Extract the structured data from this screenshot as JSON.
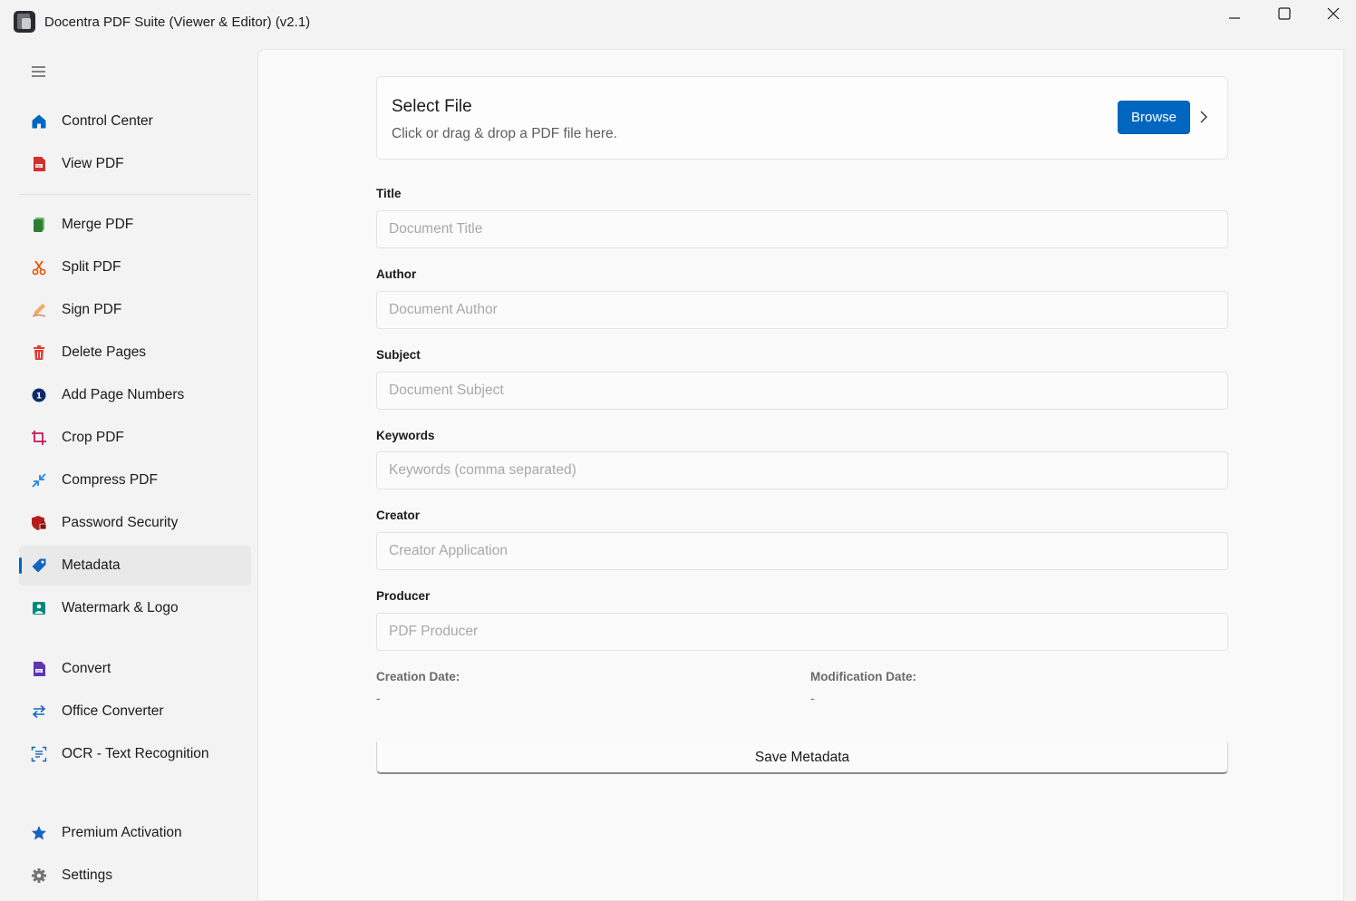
{
  "window": {
    "title": "Docentra PDF Suite (Viewer & Editor)  (v2.1)",
    "controls": [
      "minimize",
      "maximize",
      "close"
    ]
  },
  "sidebar": {
    "menu_icon": "hamburger-icon",
    "groups": [
      {
        "items": [
          {
            "label": "Control Center",
            "icon": "home-icon",
            "color": "#0067c0"
          },
          {
            "label": "View PDF",
            "icon": "pdf-icon",
            "color": "#d32f2f"
          }
        ]
      },
      {
        "items": [
          {
            "label": "Merge PDF",
            "icon": "merge-icon",
            "color": "#2e7d32"
          },
          {
            "label": "Split PDF",
            "icon": "scissors-icon",
            "color": "#e65100"
          },
          {
            "label": "Sign PDF",
            "icon": "pen-icon",
            "color": "#e8a060"
          },
          {
            "label": "Delete Pages",
            "icon": "trash-icon",
            "color": "#e53935"
          },
          {
            "label": "Add Page Numbers",
            "icon": "number-icon",
            "color": "#0d2a6b"
          },
          {
            "label": "Crop PDF",
            "icon": "crop-icon",
            "color": "#c2185b"
          },
          {
            "label": "Compress PDF",
            "icon": "compress-icon",
            "color": "#1e88e5"
          },
          {
            "label": "Password Security",
            "icon": "shield-lock-icon",
            "color": "#b71c1c"
          },
          {
            "label": "Metadata",
            "icon": "tag-icon",
            "color": "#1565c0",
            "active": true
          },
          {
            "label": "Watermark & Logo",
            "icon": "image-icon",
            "color": "#00897b"
          }
        ]
      },
      {
        "items": [
          {
            "label": "Convert",
            "icon": "convert-icon",
            "color": "#5e35b1"
          },
          {
            "label": "Office Converter",
            "icon": "swap-icon",
            "color": "#1565c0"
          },
          {
            "label": "OCR - Text Recognition",
            "icon": "scan-text-icon",
            "color": "#1565c0"
          }
        ]
      },
      {
        "items": [
          {
            "label": "Premium Activation",
            "icon": "star-icon",
            "color": "#1565c0"
          },
          {
            "label": "Settings",
            "icon": "gear-icon",
            "color": "#757575"
          }
        ]
      }
    ]
  },
  "file_card": {
    "title": "Select File",
    "subtitle": "Click or drag & drop a PDF file here.",
    "browse_label": "Browse"
  },
  "fields": [
    {
      "label": "Title",
      "placeholder": "Document Title",
      "value": ""
    },
    {
      "label": "Author",
      "placeholder": "Document Author",
      "value": ""
    },
    {
      "label": "Subject",
      "placeholder": "Document Subject",
      "value": ""
    },
    {
      "label": "Keywords",
      "placeholder": "Keywords (comma separated)",
      "value": ""
    },
    {
      "label": "Creator",
      "placeholder": "Creator Application",
      "value": ""
    },
    {
      "label": "Producer",
      "placeholder": "PDF Producer",
      "value": ""
    }
  ],
  "dates": {
    "creation_label": "Creation Date:",
    "creation_value": "-",
    "modification_label": "Modification Date:",
    "modification_value": "-"
  },
  "save_label": "Save Metadata",
  "colors": {
    "accent": "#0067c0",
    "window_bg": "#f3f3f3",
    "content_bg": "#f9f9f9"
  }
}
